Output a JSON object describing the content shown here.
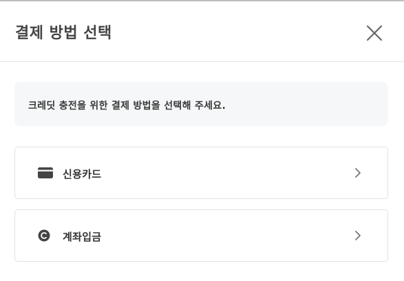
{
  "modal": {
    "title": "결제 방법 선택",
    "close_icon": "close-icon",
    "notice": "크레딧 충전을 위한 결제 방법을 선택해 주세요.",
    "options": [
      {
        "label": "신용카드",
        "icon": "credit-card-icon",
        "chevron": "chevron-right-icon"
      },
      {
        "label": "계좌입금",
        "icon": "coin-icon",
        "chevron": "chevron-right-icon"
      }
    ]
  },
  "colors": {
    "title": "#444444",
    "border": "#e2e2e2",
    "notice_bg": "#f6f7f8",
    "icon": "#444444",
    "chevron": "#777777"
  }
}
